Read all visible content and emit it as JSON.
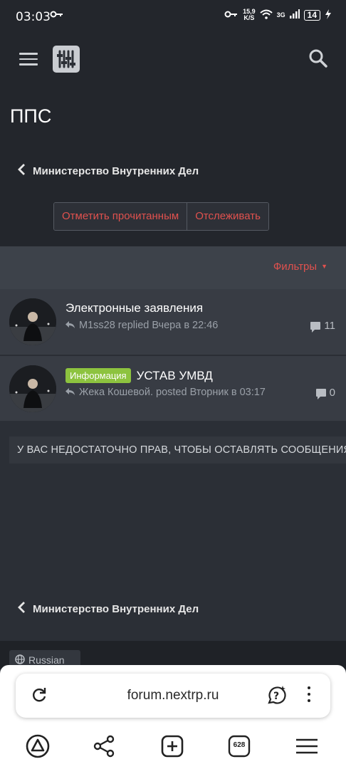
{
  "status_bar": {
    "time": "03:03",
    "speed_value": "15,9",
    "speed_unit": "K/S",
    "network": "3G",
    "battery": "14"
  },
  "header": {
    "menu_icon": "hamburger-icon",
    "logo_icon": "sliders-logo-icon",
    "search_icon": "search-icon"
  },
  "page": {
    "title": "ППС",
    "breadcrumb": "Министерство Внутренних Дел",
    "actions": [
      "Отметить прочитанным",
      "Отслеживать"
    ]
  },
  "filter": {
    "label": "Фильтры"
  },
  "threads": [
    {
      "title": "Электронные заявления",
      "badge": "",
      "meta": "M1ss28 replied Вчера в 22:46",
      "replies": "11"
    },
    {
      "title": "УСТАВ УМВД",
      "badge": "Информация",
      "meta": "Жека Кошевой. posted Вторник в 03:17",
      "replies": "0"
    }
  ],
  "notice": "У ВАС НЕДОСТАТОЧНО ПРАВ, ЧТОБЫ ОСТАВЛЯТЬ СООБЩЕНИЯ В ЭТОЙ ТЕМЕ.",
  "footer": {
    "breadcrumb": "Министерство Внутренних Дел",
    "language": "Russian"
  },
  "browser": {
    "url": "forum.nextrp.ru",
    "tab_count": "628"
  },
  "colors": {
    "accent": "#e0514e",
    "badge_green": "#8dc33f",
    "header_bg": "#23262c",
    "body_bg": "#2b2f36",
    "row_bg": "#383c44"
  }
}
